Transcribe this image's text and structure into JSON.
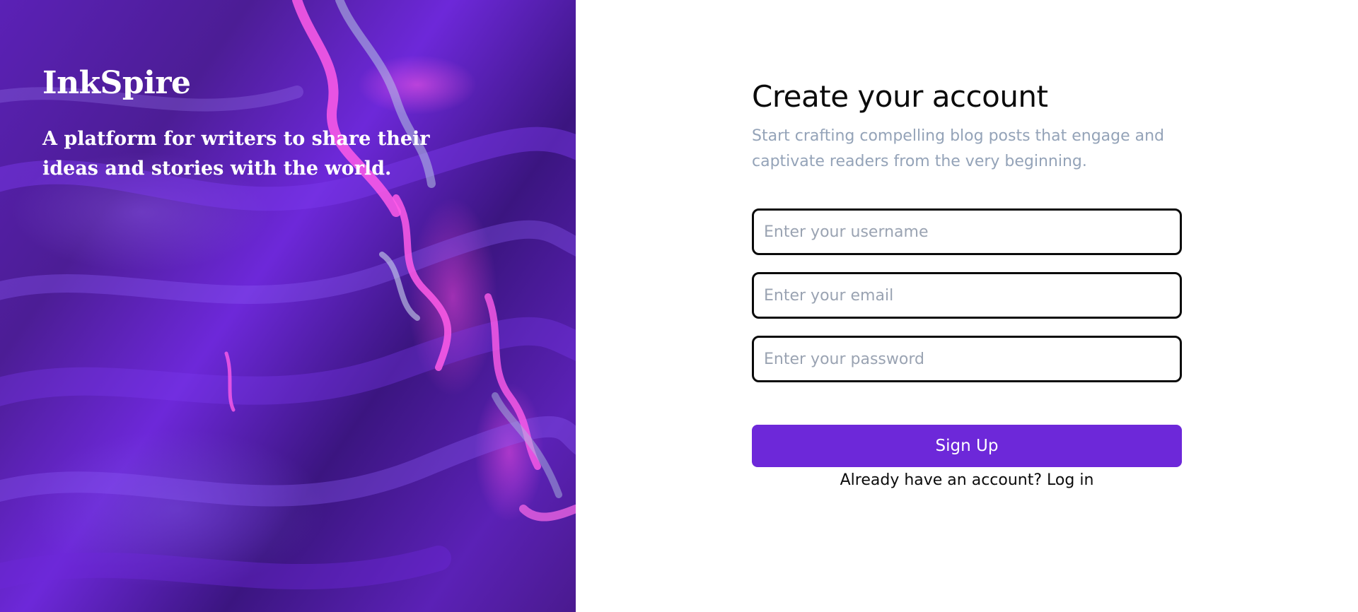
{
  "hero": {
    "brand": "InkSpire",
    "tagline": "A platform for writers to share their ideas and stories with the world."
  },
  "form": {
    "title": "Create your account",
    "subtitle": "Start crafting compelling blog posts that engage and captivate readers from the very beginning.",
    "username_placeholder": "Enter your username",
    "email_placeholder": "Enter your email",
    "password_placeholder": "Enter your password",
    "submit_label": "Sign Up",
    "login_prompt": "Already have an account?",
    "login_link": "Log in"
  },
  "colors": {
    "accent": "#6d28d9",
    "subtitle": "#94a3b8",
    "hero_base": "#4c1d95",
    "hero_highlight": "#f050dc"
  }
}
